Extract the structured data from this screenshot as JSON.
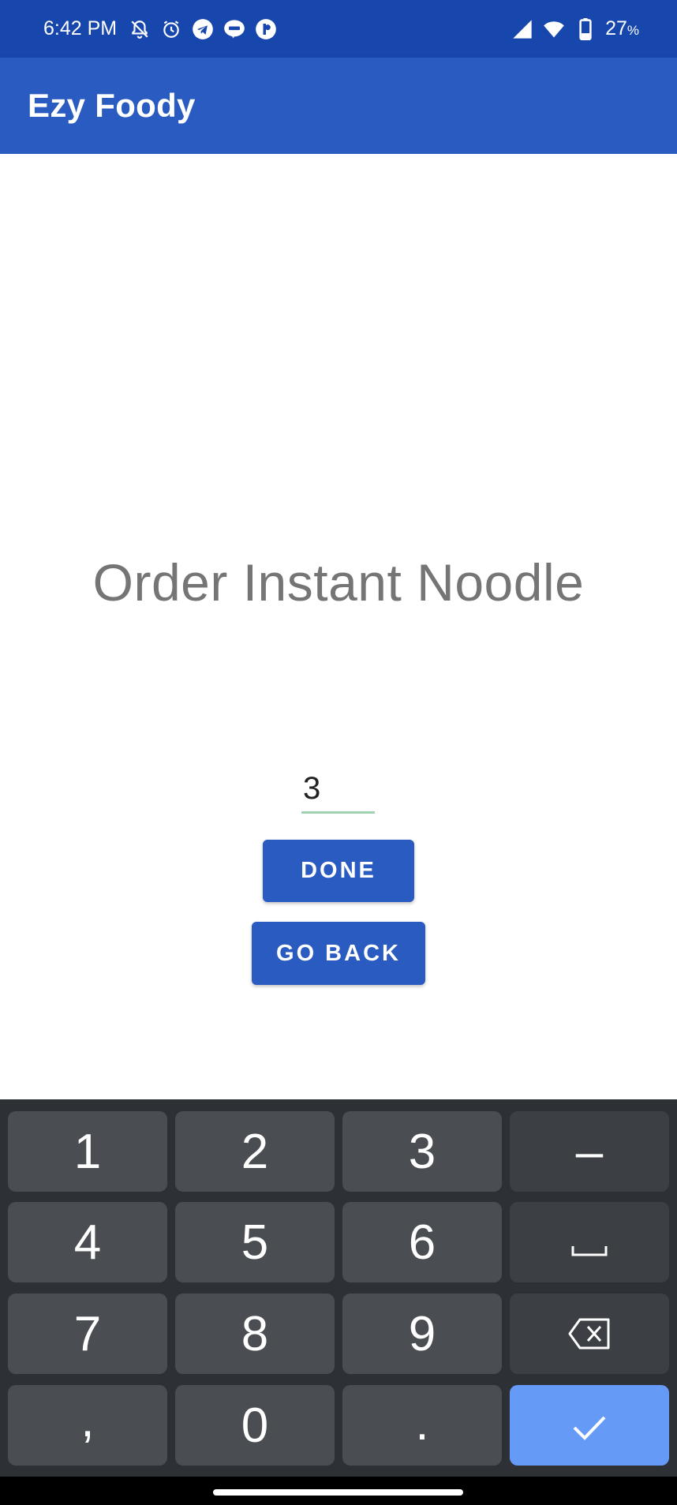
{
  "status_bar": {
    "time": "6:42 PM",
    "left_icons": [
      "bell-muted-icon",
      "alarm-icon",
      "telegram-icon",
      "line-icon",
      "app-notification-icon"
    ],
    "right_icons": [
      "signal-icon",
      "wifi-icon",
      "battery-icon"
    ],
    "battery_percent": "27",
    "battery_unit": "%"
  },
  "app_bar": {
    "title": "Ezy Foody"
  },
  "main": {
    "heading": "Order Instant Noodle",
    "quantity_value": "3",
    "done_label": "DONE",
    "go_back_label": "GO BACK"
  },
  "keyboard": {
    "rows": [
      [
        "1",
        "2",
        "3",
        "−"
      ],
      [
        "4",
        "5",
        "6",
        "space"
      ],
      [
        "7",
        "8",
        "9",
        "backspace"
      ],
      [
        ",",
        "0",
        ".",
        "enter"
      ]
    ],
    "labels": {
      "k1": "1",
      "k2": "2",
      "k3": "3",
      "minus": "–",
      "k4": "4",
      "k5": "5",
      "k6": "6",
      "k7": "7",
      "k8": "8",
      "k9": "9",
      "comma": ",",
      "k0": "0",
      "period": "."
    }
  },
  "colors": {
    "status_bar": "#1747ad",
    "app_bar": "#2a5bc1",
    "button": "#2a5bc1",
    "field_underline": "#9fd3b2",
    "keyboard_bg": "#2d3034",
    "key_bg": "#4a4d51",
    "enter_key": "#669af7"
  }
}
